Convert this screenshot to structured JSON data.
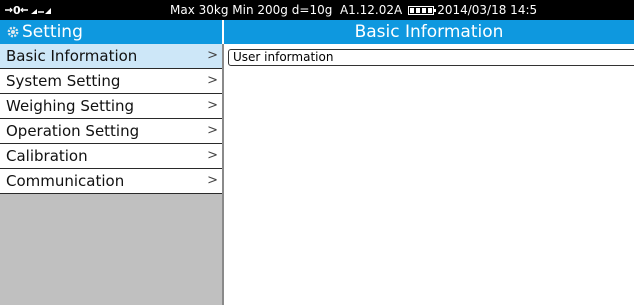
{
  "status_bar": {
    "capacity": "Max 30kg",
    "minimum": "Min 200g",
    "division": "d=10g",
    "version": "A1.12.02A",
    "datetime": "2014/03/18  14:5",
    "icons": [
      "zero-icon",
      "arrow-left-icon",
      "tare-icon",
      "stable-icon",
      "battery-icon"
    ]
  },
  "title_bar": {
    "left_title": "Setting",
    "right_title": "Basic Information",
    "color": "#0e98df"
  },
  "sidebar": {
    "items": [
      {
        "label": "Basic Information",
        "active": true
      },
      {
        "label": "System Setting"
      },
      {
        "label": "Weighing Setting"
      },
      {
        "label": "Operation Setting"
      },
      {
        "label": "Calibration"
      },
      {
        "label": "Communication"
      }
    ],
    "chevron": ">"
  },
  "content": {
    "rows": [
      {
        "label": "User information"
      }
    ]
  }
}
